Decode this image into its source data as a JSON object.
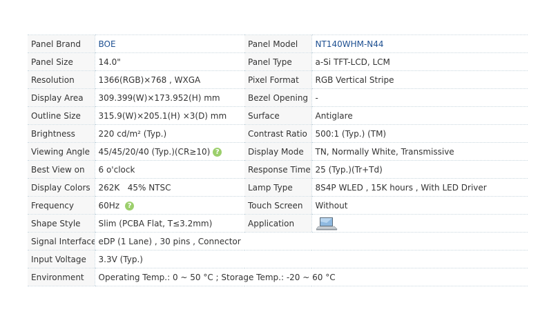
{
  "colors": {
    "link": "#1d4f91",
    "border": "#c8d6de",
    "label_bg": "#f7f7f7",
    "help_icon": "#9ccf6c"
  },
  "rows": [
    {
      "l1": "Panel Brand",
      "v1": "BOE",
      "l2": "Panel Model",
      "v2": "NT140WHM-N44"
    },
    {
      "l1": "Panel Size",
      "v1": "14.0\"",
      "l2": "Panel Type",
      "v2": "a-Si TFT-LCD, LCM"
    },
    {
      "l1": "Resolution",
      "v1": "1366(RGB)×768 , WXGA",
      "l2": "Pixel Format",
      "v2": "RGB Vertical Stripe"
    },
    {
      "l1": "Display Area",
      "v1": "309.399(W)×173.952(H) mm",
      "l2": "Bezel Opening",
      "v2": "-"
    },
    {
      "l1": "Outline Size",
      "v1": "315.9(W)×205.1(H) ×3(D) mm",
      "l2": "Surface",
      "v2": "Antiglare"
    },
    {
      "l1": "Brightness",
      "v1": "220 cd/m² (Typ.)",
      "l2": "Contrast Ratio",
      "v2": "500:1 (Typ.) (TM)"
    },
    {
      "l1": "Viewing Angle",
      "v1": "45/45/20/40 (Typ.)(CR≥10)",
      "l2": "Display Mode",
      "v2": "TN, Normally White, Transmissive"
    },
    {
      "l1": "Best View on",
      "v1": "6 o'clock",
      "l2": "Response Time",
      "v2": "25 (Typ.)(Tr+Td)"
    },
    {
      "l1": "Display Colors",
      "v1": "262K   45% NTSC",
      "l2": "Lamp Type",
      "v2": "8S4P WLED , 15K hours , With LED Driver"
    },
    {
      "l1": "Frequency",
      "v1": "60Hz",
      "l2": "Touch Screen",
      "v2": "Without"
    },
    {
      "l1": "Shape Style",
      "v1": "Slim (PCBA Flat, T≤3.2mm)",
      "l2": "Application",
      "v2": ""
    },
    {
      "l1": "Signal Interface",
      "v1": "eDP (1 Lane) , 30 pins , Connector"
    },
    {
      "l1": "Input Voltage",
      "v1": "3.3V (Typ.)"
    },
    {
      "l1": "Environment",
      "v1": "Operating Temp.: 0 ~ 50 °C ; Storage Temp.: -20 ~ 60 °C"
    }
  ],
  "icons": {
    "help": "help-icon",
    "application": "laptop-icon",
    "help_glyph": "?"
  }
}
